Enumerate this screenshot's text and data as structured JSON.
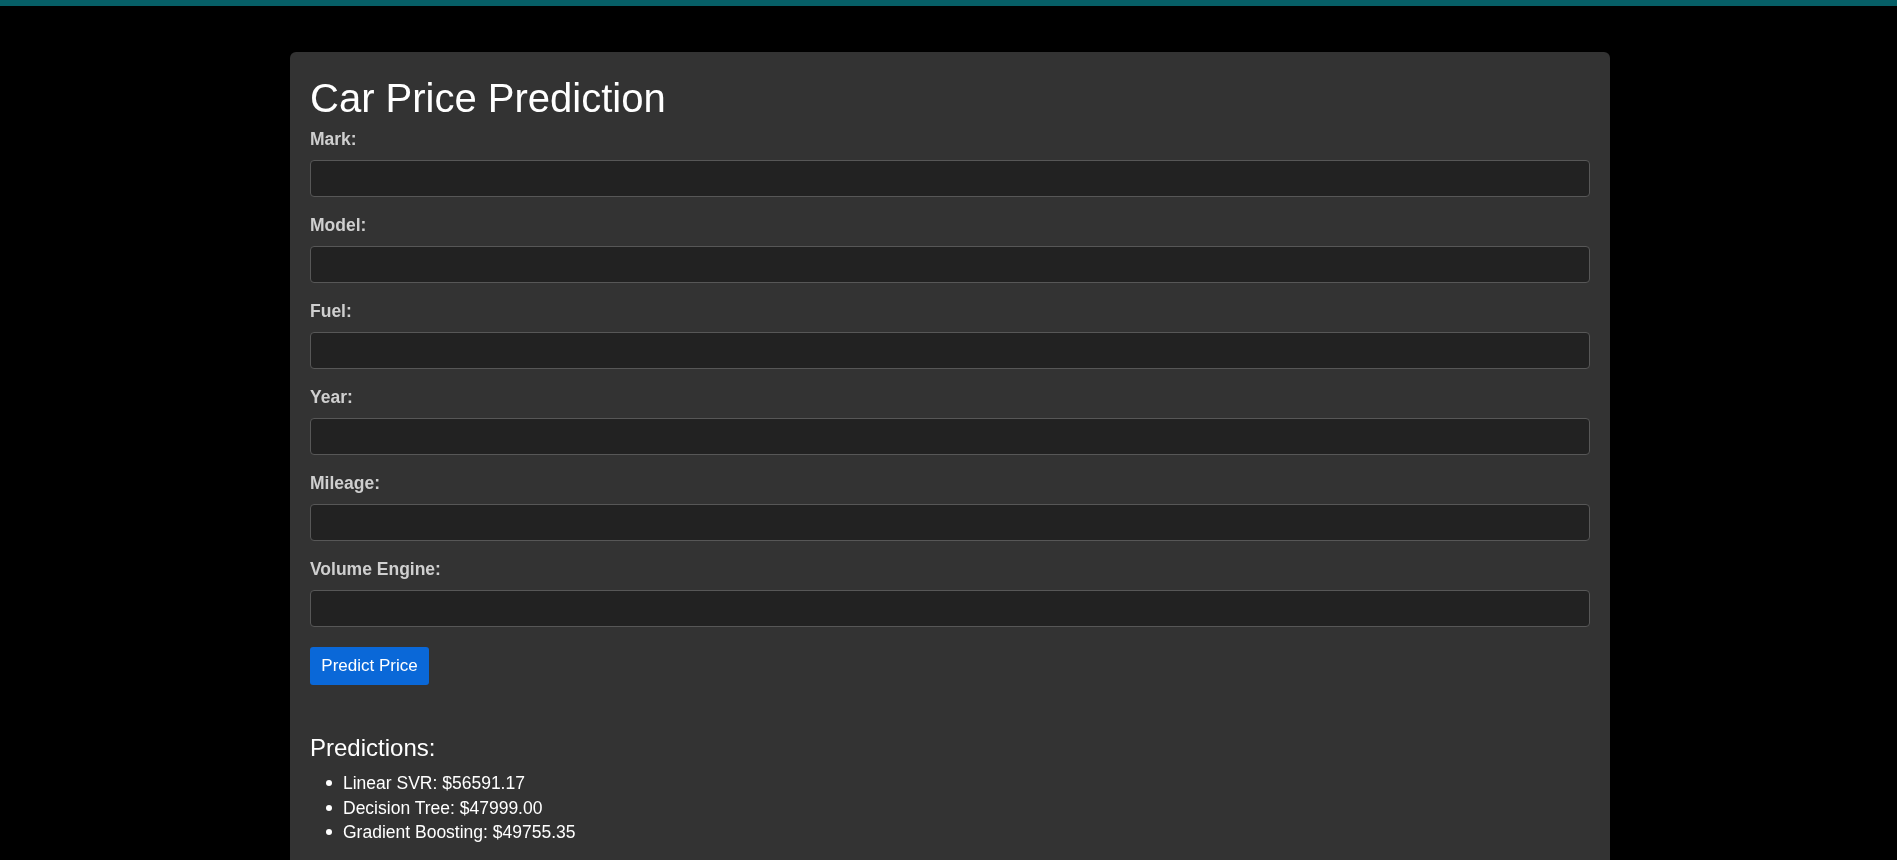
{
  "title": "Car Price Prediction",
  "form": {
    "fields": [
      {
        "label": "Mark:"
      },
      {
        "label": "Model:"
      },
      {
        "label": "Fuel:"
      },
      {
        "label": "Year:"
      },
      {
        "label": "Mileage:"
      },
      {
        "label": "Volume Engine:"
      }
    ],
    "submit_button": "Predict Price"
  },
  "predictions": {
    "heading": "Predictions:",
    "items": [
      "Linear SVR: $56591.17",
      "Decision Tree: $47999.00",
      "Gradient Boosting: $49755.35"
    ]
  }
}
